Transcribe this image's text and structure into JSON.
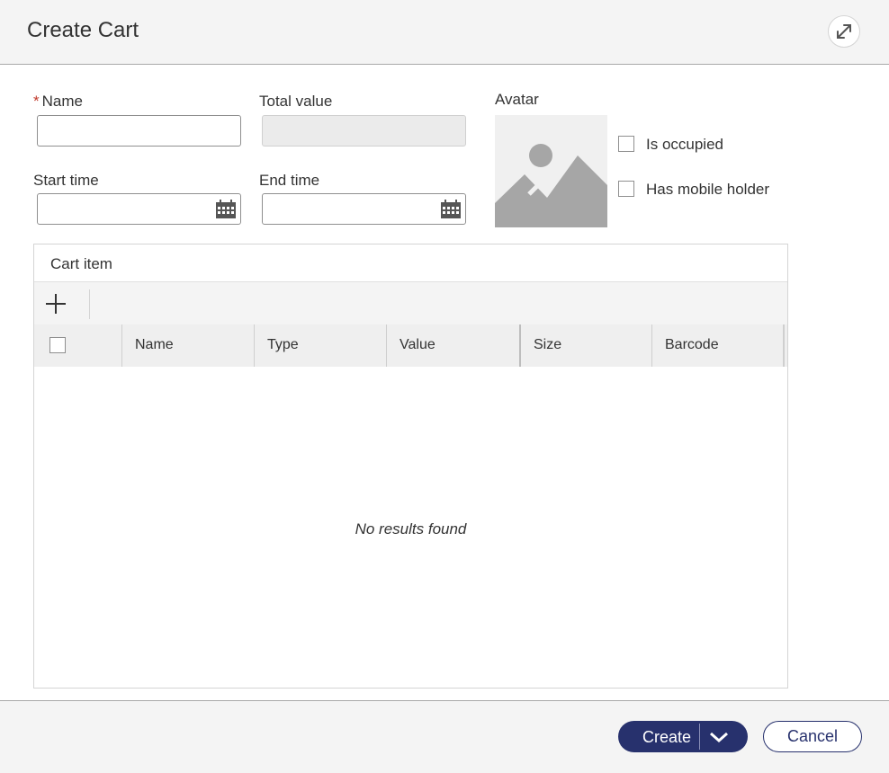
{
  "dialog": {
    "title": "Create Cart",
    "expand_icon": "expand-icon"
  },
  "form": {
    "name": {
      "label": "Name",
      "required_mark": "*",
      "value": ""
    },
    "total_value": {
      "label": "Total value",
      "value": ""
    },
    "start_time": {
      "label": "Start time",
      "value": "",
      "icon": "calendar-icon"
    },
    "end_time": {
      "label": "End time",
      "value": "",
      "icon": "calendar-icon"
    },
    "avatar": {
      "label": "Avatar",
      "icon": "image-placeholder-icon"
    },
    "is_occupied": {
      "label": "Is occupied",
      "checked": false
    },
    "has_mobile_holder": {
      "label": "Has mobile holder",
      "checked": false
    }
  },
  "cart_items": {
    "title": "Cart item",
    "add_icon": "plus-icon",
    "columns": [
      "Name",
      "Type",
      "Value",
      "Size",
      "Barcode"
    ],
    "rows": [],
    "empty_text": "No results found"
  },
  "footer": {
    "create_label": "Create",
    "create_menu_icon": "chevron-down-icon",
    "cancel_label": "Cancel"
  },
  "colors": {
    "primary": "#27316d",
    "header_bg": "#f4f4f4",
    "required": "#c0392b"
  }
}
